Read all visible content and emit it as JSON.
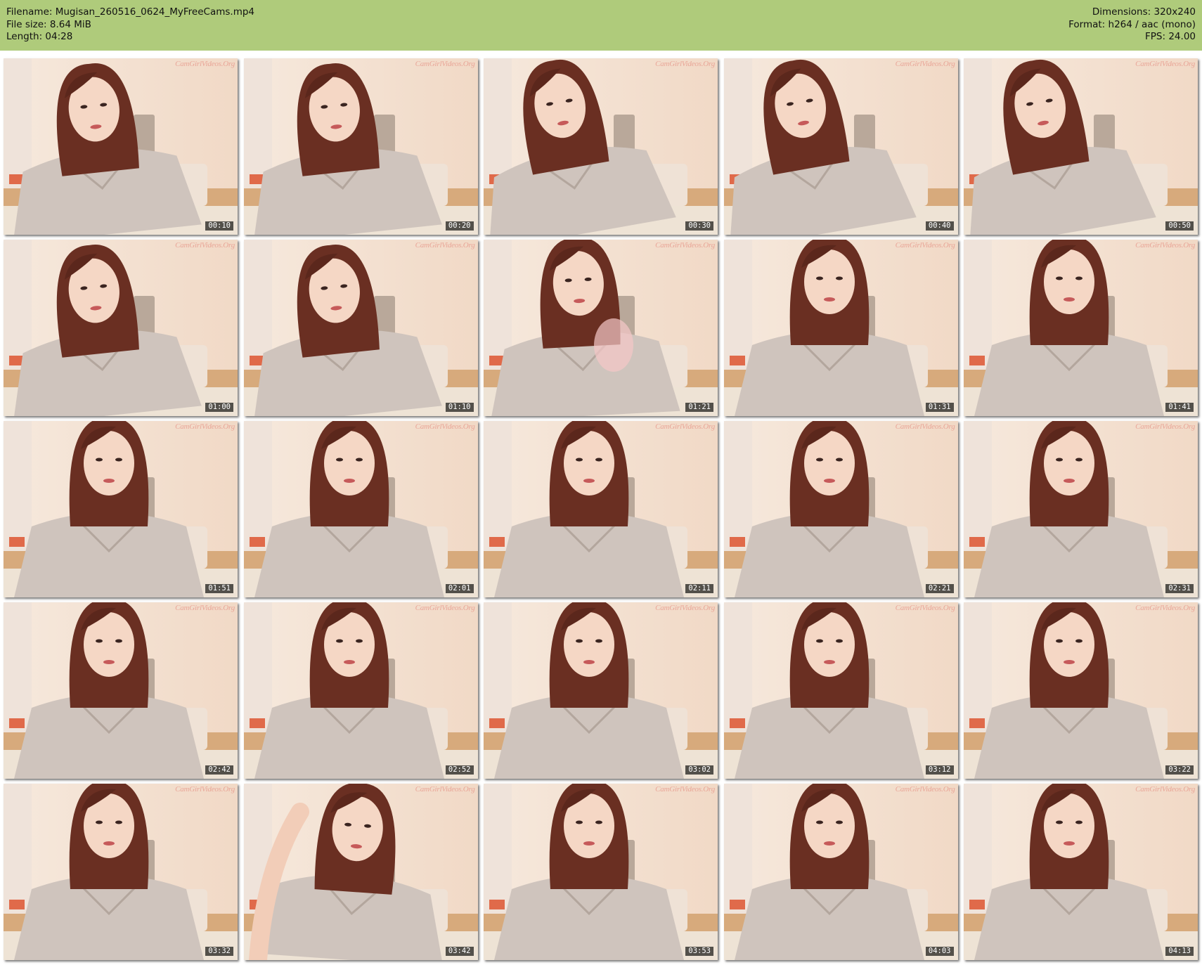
{
  "header": {
    "filename": "Filename: Mugisan_260516_0624_MyFreeCams.mp4",
    "filesize": "File size: 8.64 MiB",
    "length": "Length: 04:28",
    "dimensions": "Dimensions: 320x240",
    "format": "Format: h264 / aac (mono)",
    "fps": "FPS: 24.00"
  },
  "colors": {
    "header_bg": "#afcb7b",
    "page_bg": "#ffffff"
  },
  "thumbnails": [
    {
      "timestamp": "00:10",
      "watermark": "CamGirlVideos.Org",
      "pose": "head-down"
    },
    {
      "timestamp": "00:20",
      "watermark": "CamGirlVideos.Org",
      "pose": "head-down"
    },
    {
      "timestamp": "00:30",
      "watermark": "CamGirlVideos.Org",
      "pose": "leaning"
    },
    {
      "timestamp": "00:40",
      "watermark": "CamGirlVideos.Org",
      "pose": "leaning"
    },
    {
      "timestamp": "00:50",
      "watermark": "CamGirlVideos.Org",
      "pose": "leaning"
    },
    {
      "timestamp": "01:00",
      "watermark": "CamGirlVideos.Org",
      "pose": "head-down"
    },
    {
      "timestamp": "01:10",
      "watermark": "CamGirlVideos.Org",
      "pose": "head-down"
    },
    {
      "timestamp": "01:21",
      "watermark": "CamGirlVideos.Org",
      "pose": "wave"
    },
    {
      "timestamp": "01:31",
      "watermark": "CamGirlVideos.Org",
      "pose": "front"
    },
    {
      "timestamp": "01:41",
      "watermark": "CamGirlVideos.Org",
      "pose": "front"
    },
    {
      "timestamp": "01:51",
      "watermark": "CamGirlVideos.Org",
      "pose": "front"
    },
    {
      "timestamp": "02:01",
      "watermark": "CamGirlVideos.Org",
      "pose": "front"
    },
    {
      "timestamp": "02:11",
      "watermark": "CamGirlVideos.Org",
      "pose": "front"
    },
    {
      "timestamp": "02:21",
      "watermark": "CamGirlVideos.Org",
      "pose": "front"
    },
    {
      "timestamp": "02:31",
      "watermark": "CamGirlVideos.Org",
      "pose": "front"
    },
    {
      "timestamp": "02:42",
      "watermark": "CamGirlVideos.Org",
      "pose": "front"
    },
    {
      "timestamp": "02:52",
      "watermark": "CamGirlVideos.Org",
      "pose": "front"
    },
    {
      "timestamp": "03:02",
      "watermark": "CamGirlVideos.Org",
      "pose": "front"
    },
    {
      "timestamp": "03:12",
      "watermark": "CamGirlVideos.Org",
      "pose": "front"
    },
    {
      "timestamp": "03:22",
      "watermark": "CamGirlVideos.Org",
      "pose": "front"
    },
    {
      "timestamp": "03:32",
      "watermark": "CamGirlVideos.Org",
      "pose": "front"
    },
    {
      "timestamp": "03:42",
      "watermark": "CamGirlVideos.Org",
      "pose": "hand-hair"
    },
    {
      "timestamp": "03:53",
      "watermark": "CamGirlVideos.Org",
      "pose": "front"
    },
    {
      "timestamp": "04:03",
      "watermark": "CamGirlVideos.Org",
      "pose": "front"
    },
    {
      "timestamp": "04:13",
      "watermark": "CamGirlVideos.Org",
      "pose": "front"
    }
  ]
}
